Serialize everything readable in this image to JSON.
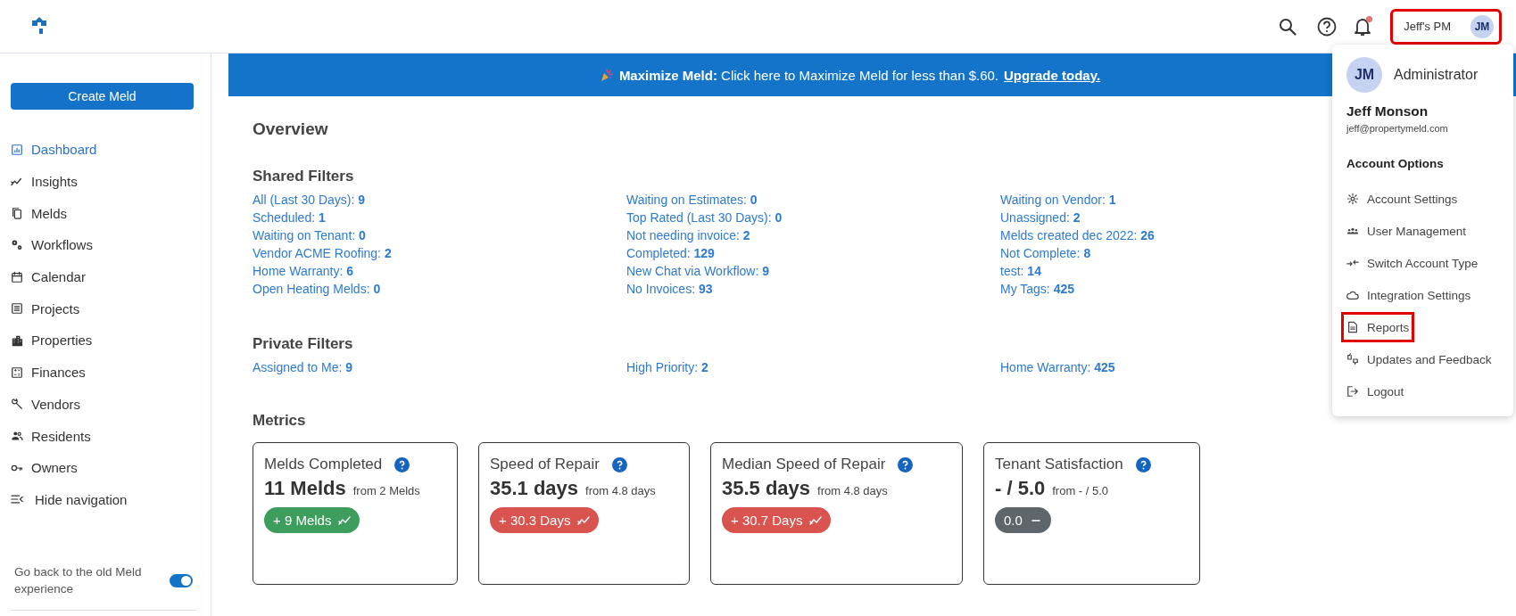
{
  "header": {
    "user_button": {
      "label": "Jeff's PM",
      "initials": "JM",
      "highlighted": true
    },
    "notifications": {
      "unread": true
    }
  },
  "sidebar": {
    "create_button": "Create Meld",
    "items": [
      {
        "label": "Dashboard",
        "selected": true
      },
      {
        "label": "Insights",
        "selected": false
      },
      {
        "label": "Melds",
        "selected": false
      },
      {
        "label": "Workflows",
        "selected": false
      },
      {
        "label": "Calendar",
        "selected": false
      },
      {
        "label": "Projects",
        "selected": false
      },
      {
        "label": "Properties",
        "selected": false
      },
      {
        "label": "Finances",
        "selected": false
      },
      {
        "label": "Vendors",
        "selected": false
      },
      {
        "label": "Residents",
        "selected": false
      },
      {
        "label": "Owners",
        "selected": false
      }
    ],
    "hide_navigation": "Hide navigation",
    "old_experience": {
      "label": "Go back to the old Meld experience",
      "on": true
    }
  },
  "banner": {
    "text": "**Maximize Meld:** Click here to Maximize Meld for less than $.60.",
    "link": "Upgrade today."
  },
  "overview": {
    "title": "Overview",
    "shared_filters": {
      "title": "Shared Filters",
      "columns": [
        [
          {
            "label": "All (Last 30 Days):",
            "count": "9"
          },
          {
            "label": "Scheduled:",
            "count": "1"
          },
          {
            "label": "Waiting on Tenant:",
            "count": "0"
          },
          {
            "label": "Vendor ACME Roofing:",
            "count": "2"
          },
          {
            "label": "Home Warranty:",
            "count": "6"
          },
          {
            "label": "Open Heating Melds:",
            "count": "0"
          }
        ],
        [
          {
            "label": "Waiting on Estimates:",
            "count": "0"
          },
          {
            "label": "Top Rated (Last 30 Days):",
            "count": "0"
          },
          {
            "label": "Not needing invoice:",
            "count": "2"
          },
          {
            "label": "Completed:",
            "count": "129"
          },
          {
            "label": "New Chat via Workflow:",
            "count": "9"
          },
          {
            "label": "No Invoices:",
            "count": "93"
          }
        ],
        [
          {
            "label": "Waiting on Vendor:",
            "count": "1"
          },
          {
            "label": "Unassigned:",
            "count": "2"
          },
          {
            "label": "Melds created dec 2022:",
            "count": "26"
          },
          {
            "label": "Not Complete:",
            "count": "8"
          },
          {
            "label": "test:",
            "count": "14"
          },
          {
            "label": "My Tags:",
            "count": "425"
          }
        ]
      ]
    },
    "private_filters": {
      "title": "Private Filters",
      "columns": [
        [
          {
            "label": "Assigned to Me:",
            "count": "9"
          }
        ],
        [
          {
            "label": "High Priority:",
            "count": "2"
          }
        ],
        [
          {
            "label": "Home Warranty:",
            "count": "425"
          }
        ]
      ]
    }
  },
  "metrics": {
    "title": "Metrics",
    "cards": [
      {
        "title": "Melds Completed",
        "value": "11 Melds",
        "comparison": "from 2 Melds",
        "change": "+ 9 Melds",
        "color": "#3c9d5d",
        "kind": "rising"
      },
      {
        "title": "Speed of Repair",
        "value": "35.1 days",
        "comparison": "from 4.8 days",
        "change": "+ 30.3 Days",
        "color": "#d9534f",
        "kind": "rising"
      },
      {
        "title": "Median Speed of Repair",
        "value": "35.5 days",
        "comparison": "from 4.8 days",
        "change": "+ 30.7 Days",
        "color": "#d9534f",
        "kind": "rising"
      },
      {
        "title": "Tenant Satisfaction",
        "value": "- / 5.0",
        "comparison": "from - / 5.0",
        "change": "0.0",
        "color": "#5f666b",
        "kind": "flat"
      }
    ]
  },
  "account_menu": {
    "initials": "JM",
    "role": "Administrator",
    "name": "Jeff Monson",
    "email": "jeff@propertymeld.com",
    "section_title": "Account Options",
    "items": [
      {
        "label": "Account Settings",
        "highlighted": false
      },
      {
        "label": "User Management",
        "highlighted": false
      },
      {
        "label": "Switch Account Type",
        "highlighted": false
      },
      {
        "label": "Integration Settings",
        "highlighted": false
      },
      {
        "label": "Reports",
        "highlighted": true
      },
      {
        "label": "Updates and Feedback",
        "highlighted": false
      },
      {
        "label": "Logout",
        "highlighted": false
      }
    ]
  }
}
